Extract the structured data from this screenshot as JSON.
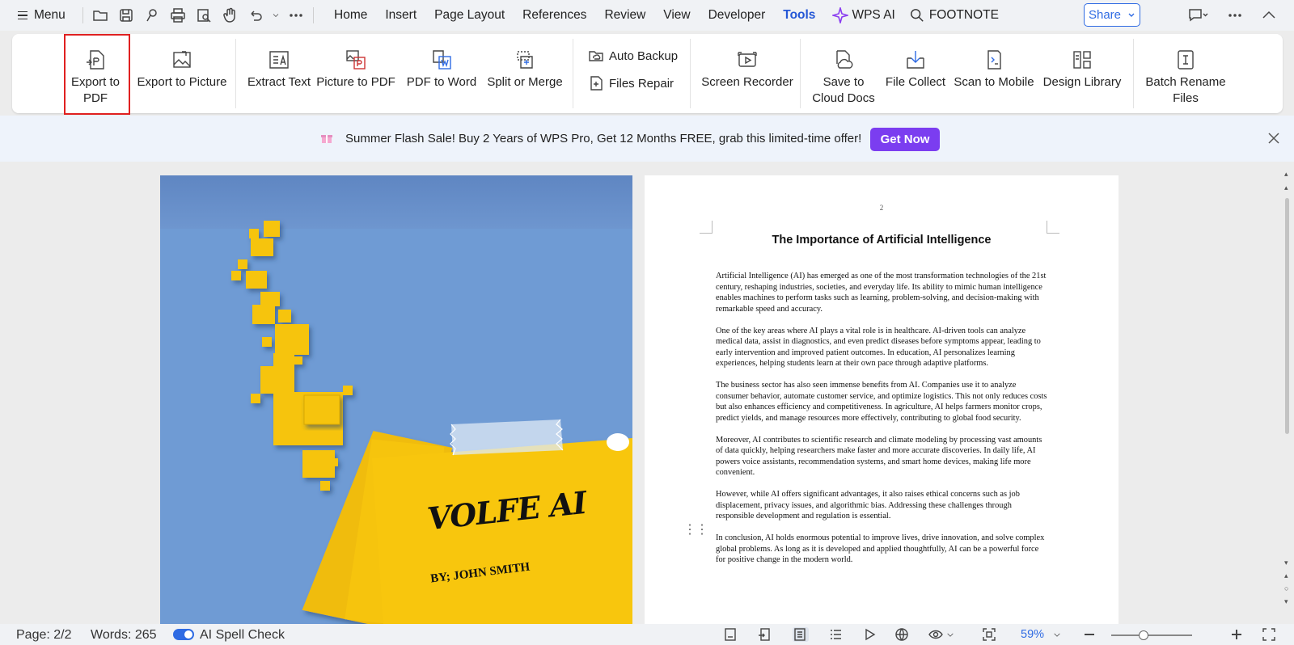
{
  "menubar": {
    "menu_label": "Menu",
    "tabs": [
      "Home",
      "Insert",
      "Page Layout",
      "References",
      "Review",
      "View",
      "Developer",
      "Tools"
    ],
    "active_tab": "Tools",
    "wps_ai_label": "WPS AI",
    "search_label": "FOOTNOTE",
    "share_label": "Share"
  },
  "ribbon": {
    "export_pdf": "Export to PDF",
    "export_picture": "Export to Picture",
    "extract_text": "Extract Text",
    "picture_to_pdf": "Picture to PDF",
    "pdf_to_word": "PDF to Word",
    "split_merge": "Split or Merge",
    "auto_backup": "Auto Backup",
    "files_repair": "Files Repair",
    "screen_recorder": "Screen Recorder",
    "save_cloud": "Save to Cloud Docs",
    "file_collect": "File Collect",
    "scan_mobile": "Scan to Mobile",
    "design_library": "Design Library",
    "batch_rename": "Batch Rename Files"
  },
  "banner": {
    "text": "Summer Flash Sale! Buy 2 Years of WPS Pro, Get 12 Months FREE, grab this limited-time offer!",
    "button": "Get Now"
  },
  "cover": {
    "title": "VOLFE AI",
    "author": "BY; JOHN SMITH"
  },
  "document": {
    "page_number": "2",
    "title": "The Importance of Artificial Intelligence",
    "paragraphs": [
      "Artificial Intelligence (AI) has emerged as one of the most transformation technologies of the 21st century, reshaping industries, societies, and everyday life. Its ability to mimic human intelligence enables machines to perform tasks such as learning, problem-solving, and decision-making with remarkable speed and accuracy.",
      "One of the key areas where AI plays a vital role is in healthcare. AI-driven tools can analyze medical data, assist in diagnostics, and even predict diseases before symptoms appear, leading to early intervention and improved patient outcomes. In education, AI personalizes learning experiences, helping students learn at their own pace through adaptive platforms.",
      "The business sector has also seen immense benefits from AI. Companies use it to analyze consumer behavior, automate customer service, and optimize logistics. This not only reduces costs but also enhances efficiency and competitiveness. In agriculture, AI helps farmers monitor crops, predict yields, and manage resources more effectively, contributing to global food security.",
      "Moreover, AI contributes to scientific research and climate modeling by processing vast amounts of data quickly, helping researchers make faster and more accurate discoveries. In daily life, AI powers voice assistants, recommendation systems, and smart home devices, making life more convenient.",
      "However, while AI offers significant advantages, it also raises ethical concerns such as job displacement, privacy issues, and algorithmic bias. Addressing these challenges through responsible development and regulation is essential.",
      "In conclusion, AI holds enormous potential to improve lives, drive innovation, and solve complex global problems. As long as it is developed and applied thoughtfully, AI can be a powerful force for positive change in the modern world."
    ]
  },
  "status": {
    "page": "Page: 2/2",
    "words": "Words: 265",
    "spell_check": "AI Spell Check",
    "spell_check_on": true,
    "zoom": "59%",
    "zoom_level": 0.4
  },
  "colors": {
    "accent": "#2f6be3",
    "get_now": "#7b3df0",
    "cover_bg": "#6f9bd4",
    "cover_yellow": "#f6c409"
  }
}
